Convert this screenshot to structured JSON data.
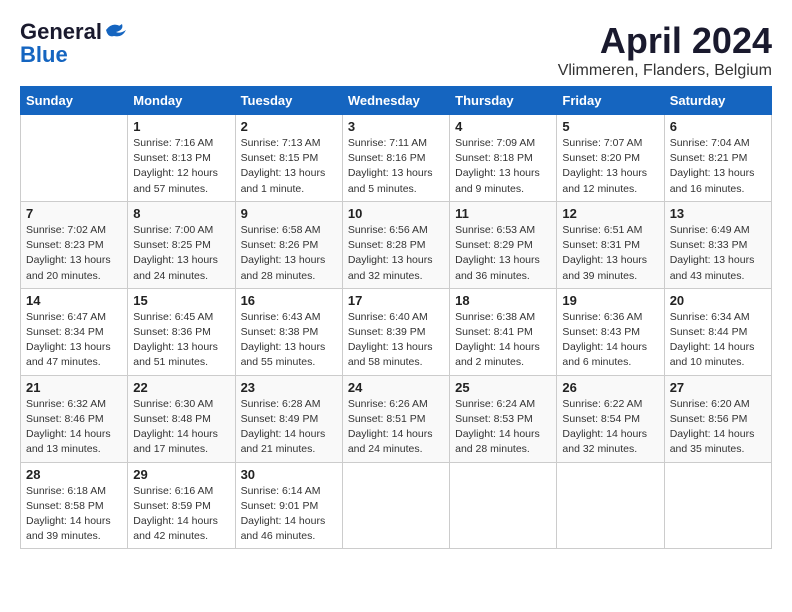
{
  "logo": {
    "line1": "General",
    "line2": "Blue"
  },
  "title": "April 2024",
  "subtitle": "Vlimmeren, Flanders, Belgium",
  "days_of_week": [
    "Sunday",
    "Monday",
    "Tuesday",
    "Wednesday",
    "Thursday",
    "Friday",
    "Saturday"
  ],
  "weeks": [
    [
      {
        "day": "",
        "sunrise": "",
        "sunset": "",
        "daylight": ""
      },
      {
        "day": "1",
        "sunrise": "Sunrise: 7:16 AM",
        "sunset": "Sunset: 8:13 PM",
        "daylight": "Daylight: 12 hours and 57 minutes."
      },
      {
        "day": "2",
        "sunrise": "Sunrise: 7:13 AM",
        "sunset": "Sunset: 8:15 PM",
        "daylight": "Daylight: 13 hours and 1 minute."
      },
      {
        "day": "3",
        "sunrise": "Sunrise: 7:11 AM",
        "sunset": "Sunset: 8:16 PM",
        "daylight": "Daylight: 13 hours and 5 minutes."
      },
      {
        "day": "4",
        "sunrise": "Sunrise: 7:09 AM",
        "sunset": "Sunset: 8:18 PM",
        "daylight": "Daylight: 13 hours and 9 minutes."
      },
      {
        "day": "5",
        "sunrise": "Sunrise: 7:07 AM",
        "sunset": "Sunset: 8:20 PM",
        "daylight": "Daylight: 13 hours and 12 minutes."
      },
      {
        "day": "6",
        "sunrise": "Sunrise: 7:04 AM",
        "sunset": "Sunset: 8:21 PM",
        "daylight": "Daylight: 13 hours and 16 minutes."
      }
    ],
    [
      {
        "day": "7",
        "sunrise": "Sunrise: 7:02 AM",
        "sunset": "Sunset: 8:23 PM",
        "daylight": "Daylight: 13 hours and 20 minutes."
      },
      {
        "day": "8",
        "sunrise": "Sunrise: 7:00 AM",
        "sunset": "Sunset: 8:25 PM",
        "daylight": "Daylight: 13 hours and 24 minutes."
      },
      {
        "day": "9",
        "sunrise": "Sunrise: 6:58 AM",
        "sunset": "Sunset: 8:26 PM",
        "daylight": "Daylight: 13 hours and 28 minutes."
      },
      {
        "day": "10",
        "sunrise": "Sunrise: 6:56 AM",
        "sunset": "Sunset: 8:28 PM",
        "daylight": "Daylight: 13 hours and 32 minutes."
      },
      {
        "day": "11",
        "sunrise": "Sunrise: 6:53 AM",
        "sunset": "Sunset: 8:29 PM",
        "daylight": "Daylight: 13 hours and 36 minutes."
      },
      {
        "day": "12",
        "sunrise": "Sunrise: 6:51 AM",
        "sunset": "Sunset: 8:31 PM",
        "daylight": "Daylight: 13 hours and 39 minutes."
      },
      {
        "day": "13",
        "sunrise": "Sunrise: 6:49 AM",
        "sunset": "Sunset: 8:33 PM",
        "daylight": "Daylight: 13 hours and 43 minutes."
      }
    ],
    [
      {
        "day": "14",
        "sunrise": "Sunrise: 6:47 AM",
        "sunset": "Sunset: 8:34 PM",
        "daylight": "Daylight: 13 hours and 47 minutes."
      },
      {
        "day": "15",
        "sunrise": "Sunrise: 6:45 AM",
        "sunset": "Sunset: 8:36 PM",
        "daylight": "Daylight: 13 hours and 51 minutes."
      },
      {
        "day": "16",
        "sunrise": "Sunrise: 6:43 AM",
        "sunset": "Sunset: 8:38 PM",
        "daylight": "Daylight: 13 hours and 55 minutes."
      },
      {
        "day": "17",
        "sunrise": "Sunrise: 6:40 AM",
        "sunset": "Sunset: 8:39 PM",
        "daylight": "Daylight: 13 hours and 58 minutes."
      },
      {
        "day": "18",
        "sunrise": "Sunrise: 6:38 AM",
        "sunset": "Sunset: 8:41 PM",
        "daylight": "Daylight: 14 hours and 2 minutes."
      },
      {
        "day": "19",
        "sunrise": "Sunrise: 6:36 AM",
        "sunset": "Sunset: 8:43 PM",
        "daylight": "Daylight: 14 hours and 6 minutes."
      },
      {
        "day": "20",
        "sunrise": "Sunrise: 6:34 AM",
        "sunset": "Sunset: 8:44 PM",
        "daylight": "Daylight: 14 hours and 10 minutes."
      }
    ],
    [
      {
        "day": "21",
        "sunrise": "Sunrise: 6:32 AM",
        "sunset": "Sunset: 8:46 PM",
        "daylight": "Daylight: 14 hours and 13 minutes."
      },
      {
        "day": "22",
        "sunrise": "Sunrise: 6:30 AM",
        "sunset": "Sunset: 8:48 PM",
        "daylight": "Daylight: 14 hours and 17 minutes."
      },
      {
        "day": "23",
        "sunrise": "Sunrise: 6:28 AM",
        "sunset": "Sunset: 8:49 PM",
        "daylight": "Daylight: 14 hours and 21 minutes."
      },
      {
        "day": "24",
        "sunrise": "Sunrise: 6:26 AM",
        "sunset": "Sunset: 8:51 PM",
        "daylight": "Daylight: 14 hours and 24 minutes."
      },
      {
        "day": "25",
        "sunrise": "Sunrise: 6:24 AM",
        "sunset": "Sunset: 8:53 PM",
        "daylight": "Daylight: 14 hours and 28 minutes."
      },
      {
        "day": "26",
        "sunrise": "Sunrise: 6:22 AM",
        "sunset": "Sunset: 8:54 PM",
        "daylight": "Daylight: 14 hours and 32 minutes."
      },
      {
        "day": "27",
        "sunrise": "Sunrise: 6:20 AM",
        "sunset": "Sunset: 8:56 PM",
        "daylight": "Daylight: 14 hours and 35 minutes."
      }
    ],
    [
      {
        "day": "28",
        "sunrise": "Sunrise: 6:18 AM",
        "sunset": "Sunset: 8:58 PM",
        "daylight": "Daylight: 14 hours and 39 minutes."
      },
      {
        "day": "29",
        "sunrise": "Sunrise: 6:16 AM",
        "sunset": "Sunset: 8:59 PM",
        "daylight": "Daylight: 14 hours and 42 minutes."
      },
      {
        "day": "30",
        "sunrise": "Sunrise: 6:14 AM",
        "sunset": "Sunset: 9:01 PM",
        "daylight": "Daylight: 14 hours and 46 minutes."
      },
      {
        "day": "",
        "sunrise": "",
        "sunset": "",
        "daylight": ""
      },
      {
        "day": "",
        "sunrise": "",
        "sunset": "",
        "daylight": ""
      },
      {
        "day": "",
        "sunrise": "",
        "sunset": "",
        "daylight": ""
      },
      {
        "day": "",
        "sunrise": "",
        "sunset": "",
        "daylight": ""
      }
    ]
  ]
}
